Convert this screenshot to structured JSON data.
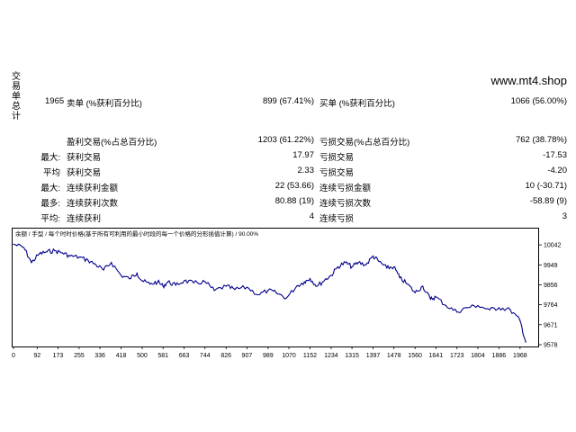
{
  "side_label": "交易单总计",
  "site": "www.mt4.shop",
  "stats": {
    "total": "1965",
    "sell_label": "卖单 (%获利百分比)",
    "sell_value": "899 (67.41%)",
    "buy_label": "买单 (%获利百分比)",
    "buy_value": "1066 (56.00%)",
    "profit_trades_label": "盈利交易(%占总百分比)",
    "profit_trades_value": "1203 (61.22%)",
    "loss_trades_label": "亏损交易(%占总百分比)",
    "loss_trades_value": "762 (38.78%)",
    "rows": [
      {
        "prefix": "最大:",
        "left_label": "获利交易",
        "left_value": "17.97",
        "right_label": "亏损交易",
        "right_value": "-17.53"
      },
      {
        "prefix": "平均",
        "left_label": "获利交易",
        "left_value": "2.33",
        "right_label": "亏损交易",
        "right_value": "-4.20"
      },
      {
        "prefix": "最大:",
        "left_label": "连续获利金额",
        "left_value": "22 (53.66)",
        "right_label": "连续亏损金额",
        "right_value": "10 (-30.71)"
      },
      {
        "prefix": "最多:",
        "left_label": "连续获利次数",
        "left_value": "80.88 (19)",
        "right_label": "连续亏损次数",
        "right_value": "-58.89 (9)"
      },
      {
        "prefix": "平均:",
        "left_label": "连续获利",
        "left_value": "4",
        "right_label": "连续亏损",
        "right_value": "3"
      }
    ]
  },
  "chart_data": {
    "type": "line",
    "legend": "余额 / 手型 / 每个时时价格(基于所有可利用的最小时段的每一个价格的分形插值计算) / 90.00%",
    "legend_items": [
      "余额",
      "手型",
      "每个时时价格(基于所有可利用的最小时段的每一个价格的分形插值计算)",
      "90.00%"
    ],
    "xlim": [
      0,
      2035
    ],
    "ylim": [
      9578,
      10080
    ],
    "x_ticks": [
      "0",
      "92",
      "173",
      "255",
      "336",
      "418",
      "500",
      "581",
      "663",
      "744",
      "826",
      "907",
      "989",
      "1070",
      "1152",
      "1234",
      "1315",
      "1397",
      "1478",
      "1560",
      "1641",
      "1723",
      "1804",
      "1886",
      "1968"
    ],
    "y_ticks": [
      "10042",
      "9949",
      "9856",
      "9764",
      "9671",
      "9578"
    ],
    "line_color": "#00008b",
    "x": [
      0,
      40,
      70,
      100,
      130,
      160,
      190,
      220,
      255,
      290,
      320,
      350,
      380,
      418,
      450,
      480,
      500,
      530,
      560,
      581,
      600,
      630,
      663,
      700,
      744,
      780,
      826,
      860,
      907,
      950,
      989,
      1020,
      1060,
      1100,
      1130,
      1152,
      1180,
      1210,
      1234,
      1260,
      1290,
      1315,
      1340,
      1370,
      1397,
      1420,
      1450,
      1478,
      1500,
      1530,
      1560,
      1590,
      1620,
      1641,
      1680,
      1723,
      1760,
      1804,
      1850,
      1886,
      1930,
      1968,
      1990
    ],
    "y": [
      10045,
      10030,
      9960,
      10000,
      10010,
      10015,
      10005,
      9990,
      9985,
      9970,
      9950,
      9925,
      9960,
      9900,
      9885,
      9910,
      9875,
      9860,
      9870,
      9850,
      9870,
      9855,
      9875,
      9865,
      9870,
      9830,
      9850,
      9835,
      9845,
      9810,
      9830,
      9820,
      9795,
      9850,
      9870,
      9885,
      9850,
      9880,
      9900,
      9940,
      9960,
      9940,
      9960,
      9950,
      9990,
      9965,
      9935,
      9940,
      9890,
      9860,
      9820,
      9850,
      9790,
      9800,
      9760,
      9730,
      9750,
      9760,
      9740,
      9750,
      9740,
      9690,
      9590
    ]
  }
}
